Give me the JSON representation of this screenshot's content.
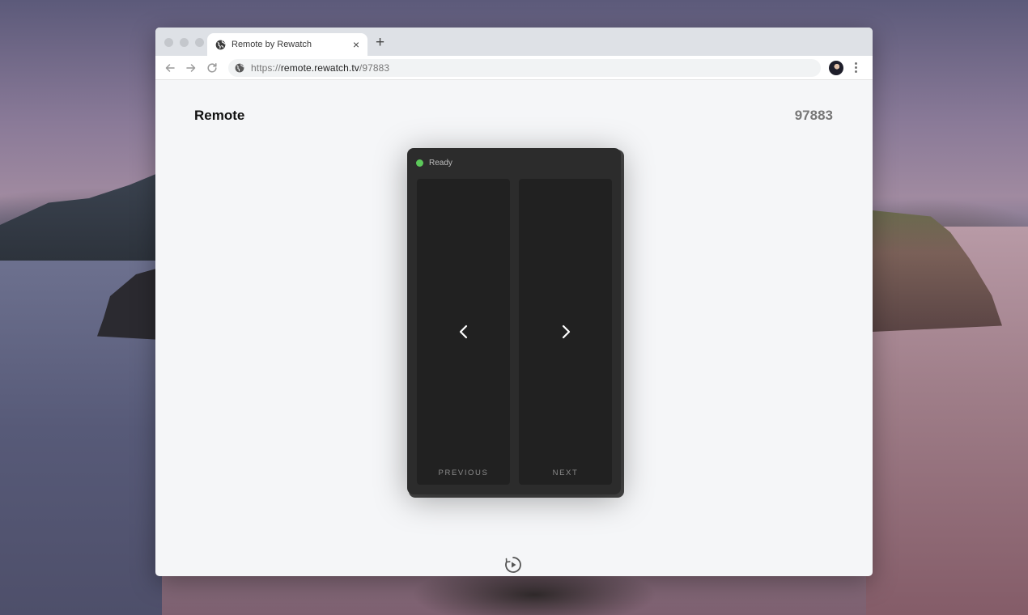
{
  "browser": {
    "tab_title": "Remote by Rewatch",
    "tab_close": "×",
    "new_tab": "+",
    "url_scheme": "https://",
    "url_host": "remote.rewatch.tv",
    "url_path": "/97883"
  },
  "page": {
    "title": "Remote",
    "session_code": "97883"
  },
  "remote": {
    "status": "Ready",
    "status_color": "#5cc85a",
    "previous_label": "PREVIOUS",
    "next_label": "NEXT"
  },
  "icons": {
    "previous": "chevron-left-icon",
    "next": "chevron-right-icon",
    "footer": "rewatch-logo-icon"
  }
}
